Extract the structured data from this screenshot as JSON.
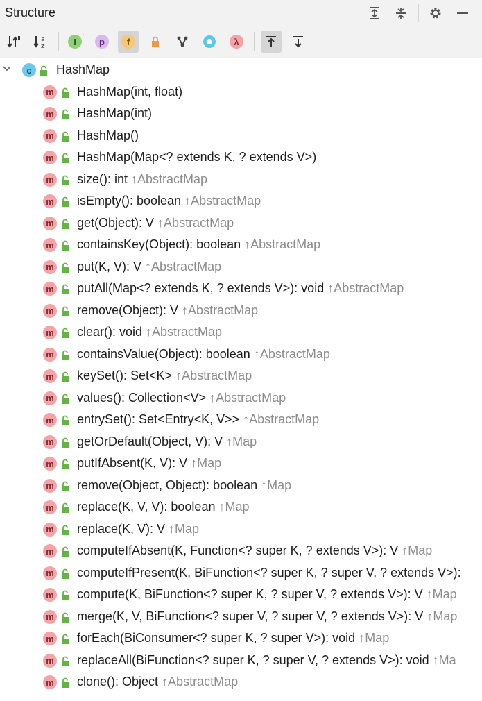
{
  "panel": {
    "title": "Structure"
  },
  "toolbar": {
    "tools": [
      {
        "name": "sort-by-visibility",
        "icon": "sort-visibility-icon"
      },
      {
        "name": "sort-alphabetically",
        "icon": "sort-alpha-icon"
      },
      {
        "name": "show-inherited",
        "icon": "inherited-icon",
        "glyph": "I"
      },
      {
        "name": "show-properties",
        "icon": "property-icon",
        "glyph": "p"
      },
      {
        "name": "show-fields",
        "icon": "field-icon",
        "glyph": "f",
        "active": true
      },
      {
        "name": "show-non-public",
        "icon": "lock-icon"
      },
      {
        "name": "group-by",
        "icon": "hierarchy-icon"
      },
      {
        "name": "show-anonymous",
        "icon": "anonymous-icon"
      },
      {
        "name": "show-lambdas",
        "icon": "lambda-icon",
        "glyph": "λ"
      },
      {
        "name": "autoscroll-to-source",
        "icon": "autoscroll-to-icon",
        "active": true
      },
      {
        "name": "autoscroll-from-source",
        "icon": "autoscroll-from-icon"
      }
    ]
  },
  "tree": {
    "root": {
      "badge": "c",
      "label": "HashMap"
    },
    "items": [
      {
        "sig": "HashMap(int, float)",
        "from": ""
      },
      {
        "sig": "HashMap(int)",
        "from": ""
      },
      {
        "sig": "HashMap()",
        "from": ""
      },
      {
        "sig": "HashMap(Map<? extends K, ? extends V>)",
        "from": ""
      },
      {
        "sig": "size(): int ",
        "from": "↑AbstractMap"
      },
      {
        "sig": "isEmpty(): boolean ",
        "from": "↑AbstractMap"
      },
      {
        "sig": "get(Object): V ",
        "from": "↑AbstractMap"
      },
      {
        "sig": "containsKey(Object): boolean ",
        "from": "↑AbstractMap"
      },
      {
        "sig": "put(K, V): V ",
        "from": "↑AbstractMap"
      },
      {
        "sig": "putAll(Map<? extends K, ? extends V>): void ",
        "from": "↑AbstractMap"
      },
      {
        "sig": "remove(Object): V ",
        "from": "↑AbstractMap"
      },
      {
        "sig": "clear(): void ",
        "from": "↑AbstractMap"
      },
      {
        "sig": "containsValue(Object): boolean ",
        "from": "↑AbstractMap"
      },
      {
        "sig": "keySet(): Set<K> ",
        "from": "↑AbstractMap"
      },
      {
        "sig": "values(): Collection<V> ",
        "from": "↑AbstractMap"
      },
      {
        "sig": "entrySet(): Set<Entry<K, V>> ",
        "from": "↑AbstractMap"
      },
      {
        "sig": "getOrDefault(Object, V): V ",
        "from": "↑Map"
      },
      {
        "sig": "putIfAbsent(K, V): V ",
        "from": "↑Map"
      },
      {
        "sig": "remove(Object, Object): boolean ",
        "from": "↑Map"
      },
      {
        "sig": "replace(K, V, V): boolean ",
        "from": "↑Map"
      },
      {
        "sig": "replace(K, V): V ",
        "from": "↑Map"
      },
      {
        "sig": "computeIfAbsent(K, Function<? super K, ? extends V>): V ",
        "from": "↑Map"
      },
      {
        "sig": "computeIfPresent(K, BiFunction<? super K, ? super V, ? extends V>):",
        "from": ""
      },
      {
        "sig": "compute(K, BiFunction<? super K, ? super V, ? extends V>): V ",
        "from": "↑Map"
      },
      {
        "sig": "merge(K, V, BiFunction<? super V, ? super V, ? extends V>): V ",
        "from": "↑Map"
      },
      {
        "sig": "forEach(BiConsumer<? super K, ? super V>): void ",
        "from": "↑Map"
      },
      {
        "sig": "replaceAll(BiFunction<? super K, ? super V, ? extends V>): void ",
        "from": "↑Ma"
      },
      {
        "sig": "clone(): Object ",
        "from": "↑AbstractMap"
      }
    ]
  },
  "colors": {
    "method_badge": "#f4a3a8",
    "lock": "#62b543",
    "inherited_text": "#8c8c8c"
  }
}
